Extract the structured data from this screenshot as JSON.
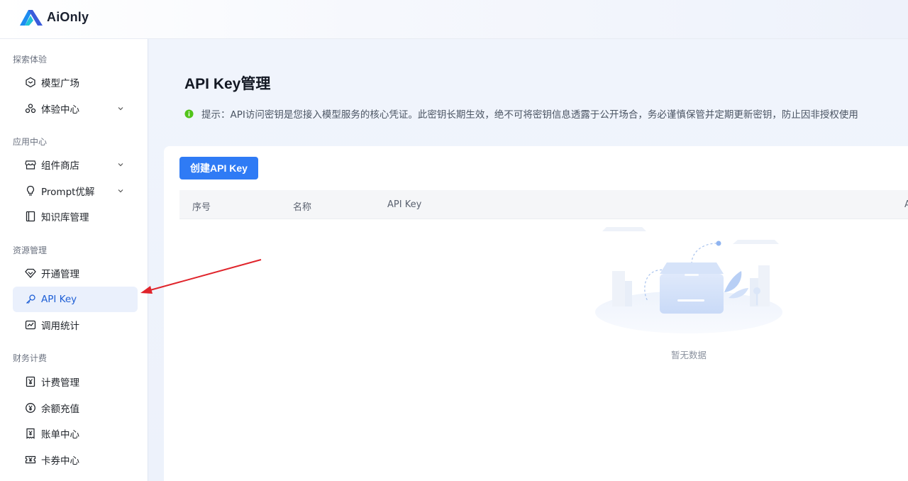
{
  "brand": {
    "name": "AiOnly"
  },
  "sidebar": {
    "groups": [
      {
        "title": "探索体验"
      },
      {
        "title": "应用中心"
      },
      {
        "title": "资源管理"
      },
      {
        "title": "财务计费"
      }
    ],
    "items": [
      {
        "label": "模型广场",
        "icon": "cube-icon"
      },
      {
        "label": "体验中心",
        "icon": "molecule-icon",
        "expandable": true
      },
      {
        "label": "组件商店",
        "icon": "store-icon",
        "expandable": true
      },
      {
        "label": "Prompt优解",
        "icon": "lightbulb-icon",
        "expandable": true
      },
      {
        "label": "知识库管理",
        "icon": "book-icon"
      },
      {
        "label": "开通管理",
        "icon": "diamond-icon"
      },
      {
        "label": "API Key",
        "icon": "key-icon",
        "active": true
      },
      {
        "label": "调用统计",
        "icon": "chart-icon"
      },
      {
        "label": "计费管理",
        "icon": "yen-receipt-icon"
      },
      {
        "label": "余额充值",
        "icon": "yen-coin-icon"
      },
      {
        "label": "账单中心",
        "icon": "bill-icon"
      },
      {
        "label": "卡券中心",
        "icon": "coupon-icon"
      }
    ]
  },
  "main": {
    "title": "API Key管理",
    "tip": "提示：API访问密钥是您接入模型服务的核心凭证。此密钥长期生效，绝不可将密钥信息透露于公开场合，务必谨慎保管并定期更新密钥，防止因非授权使用",
    "create_button": "创建API Key",
    "table": {
      "columns": [
        "序号",
        "名称",
        "API Key",
        "A"
      ]
    },
    "empty_text": "暂无数据"
  },
  "colors": {
    "primary": "#2f7bf5",
    "active_bg": "#eaf0fc",
    "active_text": "#1e5fd6",
    "tip_green": "#52c41a",
    "annotation_arrow": "#e0242b"
  }
}
